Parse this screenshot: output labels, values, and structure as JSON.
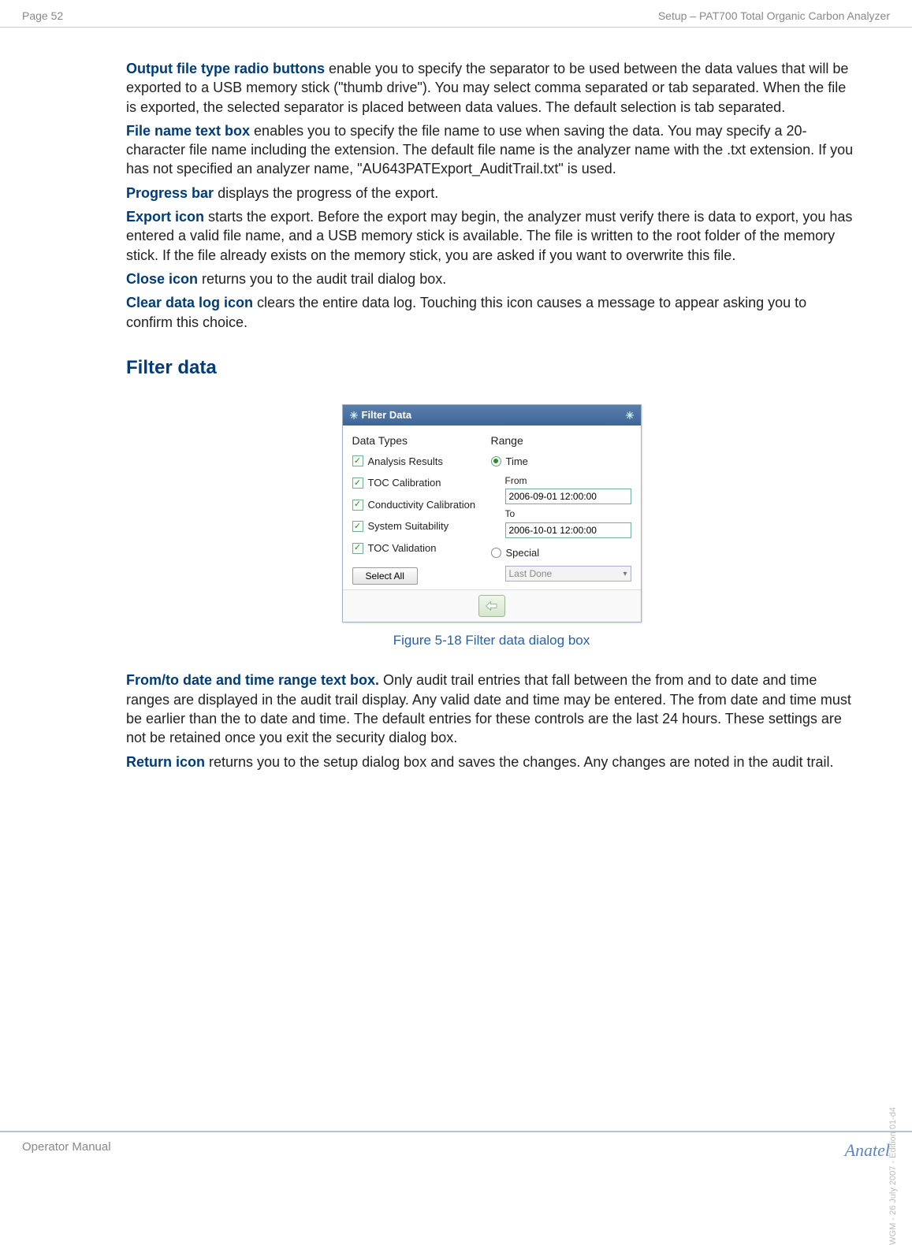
{
  "header": {
    "page_label": "Page 52",
    "doc_title": "Setup – PAT700 Total Organic Carbon Analyzer"
  },
  "body": {
    "p1_term": "Output file type radio buttons",
    "p1_text": " enable you to specify the separator to be used between the data values that will be exported to a USB memory stick (\"thumb drive\"). You may select comma separated or tab separated. When the file is exported, the selected separator is placed between data values. The default selection is tab separated.",
    "p2_term": "File name text box",
    "p2_text": " enables you to specify the file name to use when saving the data. You may specify a 20-character file name including the extension. The default file name is the analyzer name with the .txt extension. If you has not specified an analyzer name, \"AU643PATExport_AuditTrail.txt\" is used.",
    "p3_term": "Progress bar",
    "p3_text": " displays the progress of the export.",
    "p4_term": "Export icon",
    "p4_text": " starts the export. Before the export may begin, the analyzer must verify there is data to export, you has entered a valid file name, and a USB memory stick is available. The file is written to the root folder of the memory stick. If the file already exists on the memory stick, you are asked if you want to overwrite this file.",
    "p5_term": "Close icon",
    "p5_text": " returns you to the audit trail dialog box.",
    "p6_term": "Clear data log icon",
    "p6_text": " clears the entire data log. Touching this icon causes a message to appear asking you to confirm this choice.",
    "section_heading": "Filter data",
    "p7_term": "From/to date and time range text box.",
    "p7_text": " Only audit trail entries that fall between the from and to date and time ranges are displayed in the audit trail display. Any valid date and time may be entered. The from date and time must be earlier than the to date and time. The default entries for these controls are the last 24 hours. These settings are not be retained once you exit the security dialog box.",
    "p8_term": "Return icon",
    "p8_text": " returns you to the setup dialog box and saves the changes. Any changes are noted in the audit trail."
  },
  "dialog": {
    "title": "Filter Data",
    "col1_heading": "Data Types",
    "chk1": "Analysis Results",
    "chk2": "TOC Calibration",
    "chk3": "Conductivity Calibration",
    "chk4": "System Suitability",
    "chk5": "TOC Validation",
    "select_all_btn": "Select All",
    "col2_heading": "Range",
    "radio_time": "Time",
    "from_label": "From",
    "from_value": "2006-09-01 12:00:00",
    "to_label": "To",
    "to_value": "2006-10-01 12:00:00",
    "radio_special": "Special",
    "special_value": "Last Done"
  },
  "figure_caption": "Figure 5-18 Filter data dialog box",
  "footer": {
    "left": "Operator Manual",
    "right": "Anatel"
  },
  "side_text": "WGM - 26 July 2007 - Edition 01-d4"
}
